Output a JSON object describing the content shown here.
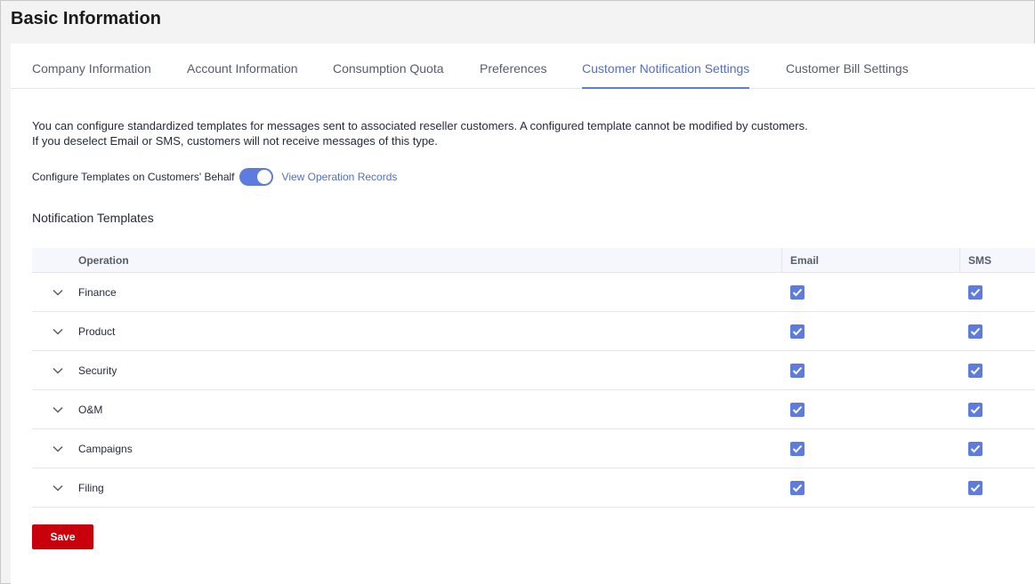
{
  "page": {
    "title": "Basic Information"
  },
  "tabs": [
    {
      "label": "Company Information",
      "active": false
    },
    {
      "label": "Account Information",
      "active": false
    },
    {
      "label": "Consumption Quota",
      "active": false
    },
    {
      "label": "Preferences",
      "active": false
    },
    {
      "label": "Customer Notification Settings",
      "active": true
    },
    {
      "label": "Customer Bill Settings",
      "active": false
    }
  ],
  "description": {
    "line1": "You can configure standardized templates for messages sent to associated reseller customers. A configured template cannot be modified by customers.",
    "line2": "If you deselect Email or SMS, customers will not receive messages of this type."
  },
  "configure": {
    "label": "Configure Templates on Customers' Behalf",
    "enabled": true,
    "records_link": "View Operation Records"
  },
  "templates": {
    "title": "Notification Templates",
    "columns": {
      "operation": "Operation",
      "email": "Email",
      "sms": "SMS"
    },
    "rows": [
      {
        "operation": "Finance",
        "email": true,
        "sms": true
      },
      {
        "operation": "Product",
        "email": true,
        "sms": true
      },
      {
        "operation": "Security",
        "email": true,
        "sms": true
      },
      {
        "operation": "O&M",
        "email": true,
        "sms": true
      },
      {
        "operation": "Campaigns",
        "email": true,
        "sms": true
      },
      {
        "operation": "Filing",
        "email": true,
        "sms": true
      }
    ]
  },
  "actions": {
    "save_label": "Save"
  },
  "icons": {
    "expand": "chevron-down-icon",
    "checked": "checkmark-icon"
  },
  "colors": {
    "accent": "#5e7ce0",
    "save": "#c7000b",
    "link": "#526ecc"
  }
}
